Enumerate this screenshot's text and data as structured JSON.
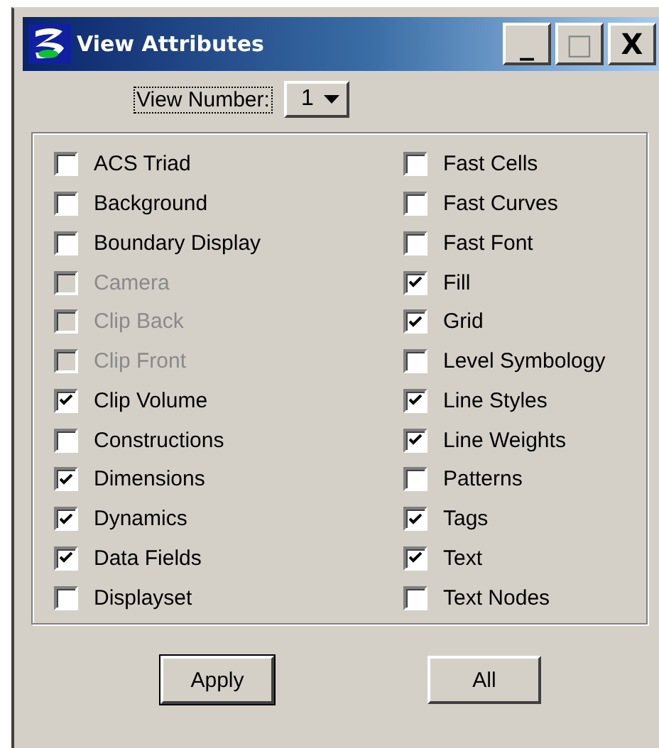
{
  "window": {
    "title": "View Attributes",
    "controls": [
      "_",
      "□",
      "X"
    ]
  },
  "view_number": {
    "label": "View Number:",
    "value": "1"
  },
  "attributes": [
    {
      "label": "ACS Triad",
      "checked": false,
      "disabled": false
    },
    {
      "label": "Background",
      "checked": false,
      "disabled": false
    },
    {
      "label": "Boundary Display",
      "checked": false,
      "disabled": false
    },
    {
      "label": "Camera",
      "checked": false,
      "disabled": true
    },
    {
      "label": "Clip Back",
      "checked": false,
      "disabled": true
    },
    {
      "label": "Clip Front",
      "checked": false,
      "disabled": true
    },
    {
      "label": "Clip Volume",
      "checked": true,
      "disabled": false
    },
    {
      "label": "Constructions",
      "checked": false,
      "disabled": false
    },
    {
      "label": "Dimensions",
      "checked": true,
      "disabled": false
    },
    {
      "label": "Dynamics",
      "checked": true,
      "disabled": false
    },
    {
      "label": "Data Fields",
      "checked": true,
      "disabled": false
    },
    {
      "label": "Displayset",
      "checked": false,
      "disabled": false
    },
    {
      "label": "Fast Cells",
      "checked": false,
      "disabled": false
    },
    {
      "label": "Fast Curves",
      "checked": false,
      "disabled": false
    },
    {
      "label": "Fast Font",
      "checked": false,
      "disabled": false
    },
    {
      "label": "Fill",
      "checked": true,
      "disabled": false
    },
    {
      "label": "Grid",
      "checked": true,
      "disabled": false
    },
    {
      "label": "Level Symbology",
      "checked": false,
      "disabled": false
    },
    {
      "label": "Line Styles",
      "checked": true,
      "disabled": false
    },
    {
      "label": "Line Weights",
      "checked": true,
      "disabled": false
    },
    {
      "label": "Patterns",
      "checked": false,
      "disabled": false
    },
    {
      "label": "Tags",
      "checked": true,
      "disabled": false
    },
    {
      "label": "Text",
      "checked": true,
      "disabled": false
    },
    {
      "label": "Text Nodes",
      "checked": false,
      "disabled": false
    }
  ],
  "buttons": [
    {
      "label": "Apply",
      "default": true
    },
    {
      "label": "All",
      "default": false
    }
  ]
}
